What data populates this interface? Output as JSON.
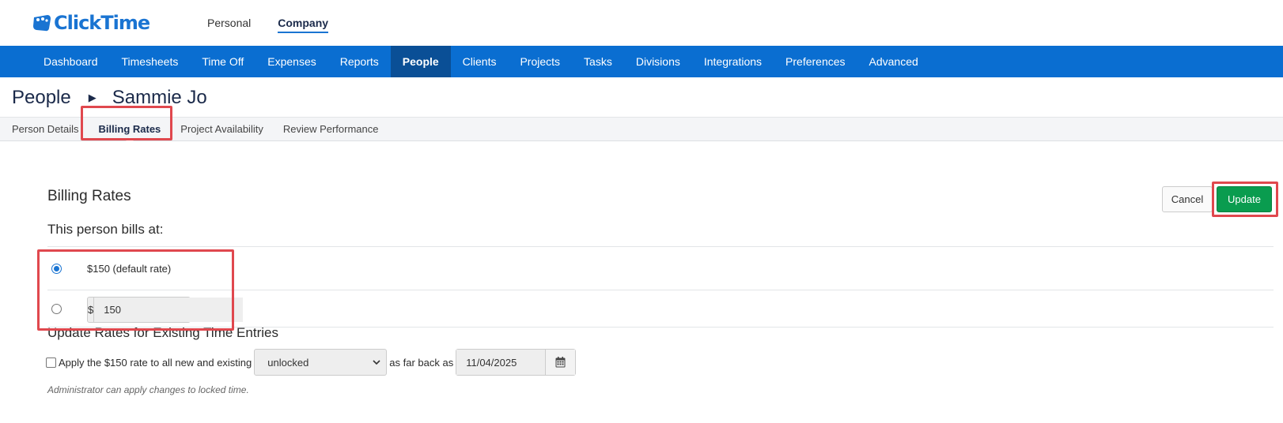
{
  "app": {
    "logo_text": "ClickTime"
  },
  "top_nav": [
    {
      "label": "Personal",
      "active": false
    },
    {
      "label": "Company",
      "active": true
    }
  ],
  "main_nav": [
    {
      "label": "Dashboard",
      "active": false
    },
    {
      "label": "Timesheets",
      "active": false
    },
    {
      "label": "Time Off",
      "active": false
    },
    {
      "label": "Expenses",
      "active": false
    },
    {
      "label": "Reports",
      "active": false
    },
    {
      "label": "People",
      "active": true
    },
    {
      "label": "Clients",
      "active": false
    },
    {
      "label": "Projects",
      "active": false
    },
    {
      "label": "Tasks",
      "active": false
    },
    {
      "label": "Divisions",
      "active": false
    },
    {
      "label": "Integrations",
      "active": false
    },
    {
      "label": "Preferences",
      "active": false
    },
    {
      "label": "Advanced",
      "active": false
    }
  ],
  "breadcrumb": {
    "parent": "People",
    "current": "Sammie Jo"
  },
  "sub_tabs": [
    {
      "label": "Person Details",
      "active": false
    },
    {
      "label": "Billing Rates",
      "active": true
    },
    {
      "label": "Project Availability",
      "active": false
    },
    {
      "label": "Review Performance",
      "active": false
    }
  ],
  "billing": {
    "title": "Billing Rates",
    "bills_at_label": "This person bills at:",
    "default_rate_label": "$150 (default rate)",
    "custom_rate_prefix": "$",
    "custom_rate_value": "150",
    "selected_option": "default"
  },
  "actions": {
    "cancel_label": "Cancel",
    "update_label": "Update"
  },
  "update_existing": {
    "title": "Update Rates for Existing Time Entries",
    "apply_label": "Apply the $150 rate to all new and existing",
    "scope_selected": "unlocked",
    "as_far_back_label": "as far back as",
    "date_value": "11/04/2025",
    "note": "Administrator can apply changes to locked time."
  },
  "colors": {
    "brand_blue": "#1a74d2",
    "nav_bg": "#0a6ed1",
    "nav_active": "#0a4f96",
    "update_green": "#0a9c4f",
    "highlight_red": "#e0484e"
  }
}
